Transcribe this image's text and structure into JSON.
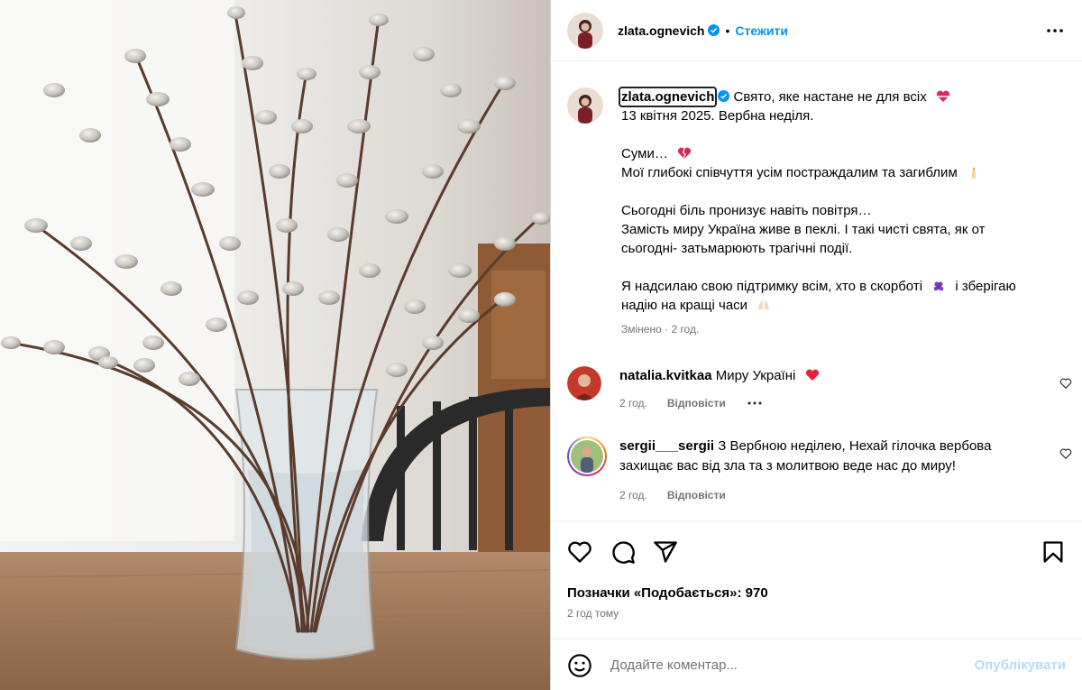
{
  "header": {
    "username": "zlata.ognevich",
    "follow_label": "Стежити",
    "separator": "•"
  },
  "caption": {
    "username": "zlata.ognevich",
    "lines": [
      "Свято, яке настане не для всіх",
      "13 квітня 2025. Вербна неділя.",
      "",
      "Суми…",
      "Мої глибокі співчуття усім постраждалим та загиблим",
      "",
      "Сьогодні біль пронизує навіть повітря…",
      "Замість миру Україна живе в пеклі. І такі чисті свята, як от",
      "сьогодні- затьмарюють трагічні події.",
      "",
      "Я надсилаю свою підтримку всім, хто в скорботі",
      "і зберігаю",
      "надію на кращі часи"
    ],
    "edited_label": "Змінено",
    "edited_time": "2 год."
  },
  "comments": [
    {
      "username": "natalia.kvitkaa",
      "text": "Миру Україні",
      "time": "2 год.",
      "reply_label": "Відповісти"
    },
    {
      "username": "sergii___sergii",
      "text": "З Вербною неділею, Нехай гілочка вербова захищає вас від зла та з молитвою веде нас до миру!",
      "time": "2 год.",
      "reply_label": "Відповісти"
    }
  ],
  "actions": {
    "likes_text": "Позначки «Подобається»: 970",
    "posted_ago": "2 год тому"
  },
  "comment_box": {
    "placeholder": "Додайте коментар...",
    "publish_label": "Опублікувати"
  },
  "icons": [
    "verified-badge-icon",
    "more-options-icon",
    "heart-icon",
    "comment-icon",
    "share-icon",
    "bookmark-icon",
    "emoji-icon"
  ],
  "colors": {
    "accent": "#0095f6",
    "muted": "#737373",
    "publish_disabled": "#b3dbff",
    "heart_red": "#ed1c3a"
  }
}
